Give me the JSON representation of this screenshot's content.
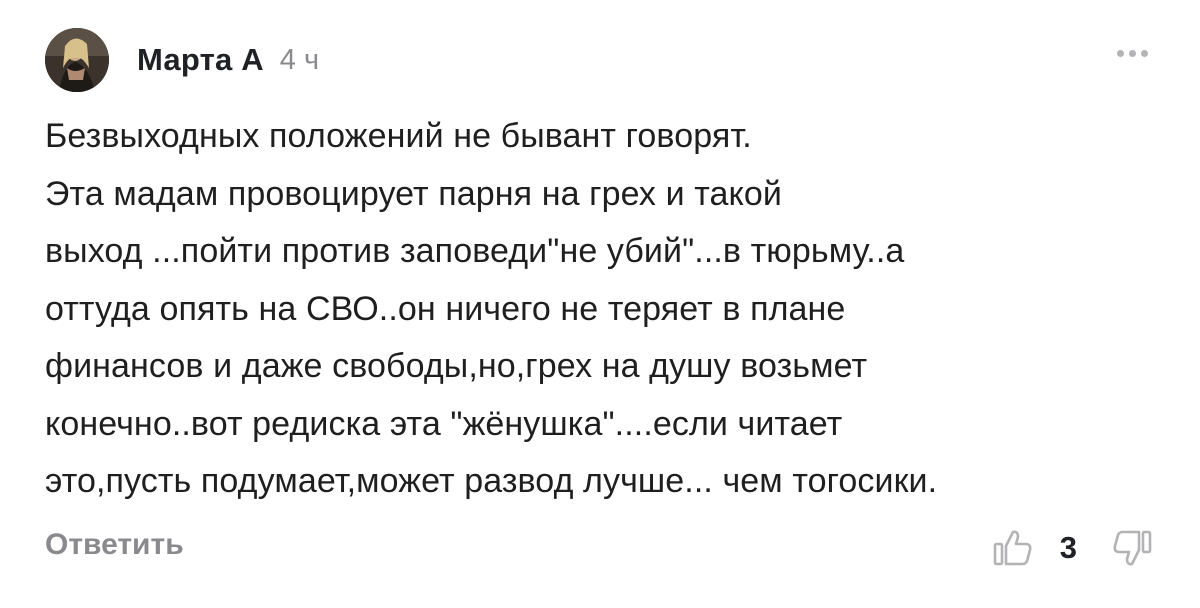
{
  "comment": {
    "author": "Марта А",
    "time": "4 ч",
    "text": "Безвыходных положений не бывант говорят.\nЭта мадам провоцирует парня на грех и такой\nвыход ...пойти  против заповеди\"не убий\"...в тюрьму..а\nоттуда опять на СВО..он ничего не теряет в плане\nфинансов и даже свободы,но,грех на душу возьмет\nконечно..вот редиска эта \"жёнушка\"....если читает\nэто,пусть подумает,может развод лучше... чем тогосики.",
    "reply_label": "Ответить",
    "likes_count": "3"
  },
  "icons": {
    "avatar": "avatar-photo",
    "more": "more-dots-icon",
    "like": "thumb-up-icon",
    "dislike": "thumb-down-icon"
  },
  "colors": {
    "text": "#1f1f1f",
    "muted": "#8a8a8e",
    "icon": "#b3b3b6"
  }
}
